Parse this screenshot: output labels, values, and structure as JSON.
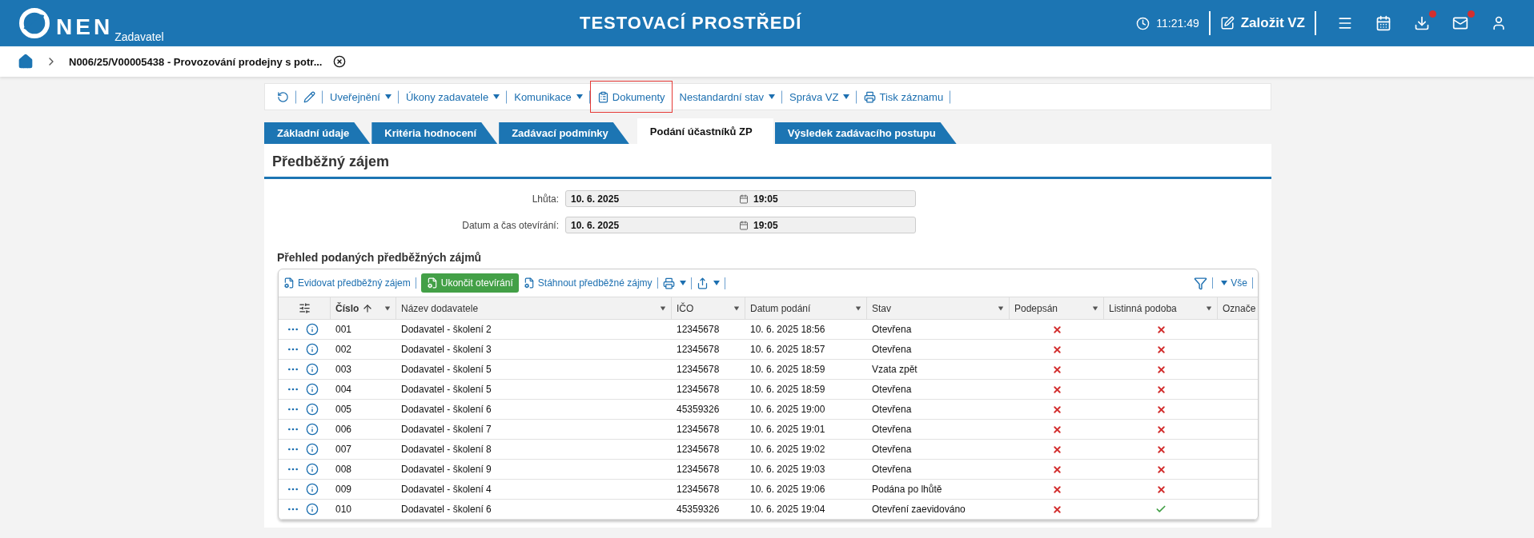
{
  "header": {
    "logo": "NEN",
    "logo_sub": "Zadavatel",
    "environment": "TESTOVACÍ PROSTŘEDÍ",
    "time": "11:21:49",
    "create_button": "Založit VZ",
    "icons": [
      {
        "kind": "menu",
        "badge": false
      },
      {
        "kind": "calendar",
        "badge": false
      },
      {
        "kind": "download",
        "badge": true
      },
      {
        "kind": "mail",
        "badge": true
      },
      {
        "kind": "user",
        "badge": false
      }
    ]
  },
  "breadcrumb": {
    "title": "N006/25/V00005438 - Provozování prodejny s potr..."
  },
  "toolbar": [
    {
      "kind": "refresh"
    },
    {
      "kind": "edit"
    },
    {
      "kind": "menu",
      "label": "Uveřejnění",
      "highlighted": false
    },
    {
      "kind": "menu",
      "label": "Úkony zadavatele",
      "highlighted": false
    },
    {
      "kind": "menu",
      "label": "Komunikace",
      "highlighted": false
    },
    {
      "kind": "doc",
      "label": "Dokumenty",
      "highlighted": true
    },
    {
      "kind": "menu",
      "label": "Nestandardní stav",
      "highlighted": false
    },
    {
      "kind": "menu",
      "label": "Správa VZ",
      "highlighted": false
    },
    {
      "kind": "print",
      "label": "Tisk záznamu",
      "highlighted": false
    }
  ],
  "tabs": [
    {
      "label": "Základní údaje",
      "selected": false
    },
    {
      "label": "Kritéria hodnocení",
      "selected": false
    },
    {
      "label": "Zadávací podmínky",
      "selected": false
    },
    {
      "label": "Podání účastníků ZP",
      "selected": true
    },
    {
      "label": "Výsledek zadávacího postupu",
      "selected": false
    }
  ],
  "section": {
    "title": "Předběžný zájem",
    "fields": [
      {
        "label": "Lhůta:",
        "date": "10. 6. 2025",
        "time": "19:05"
      },
      {
        "label": "Datum a čas otevírání:",
        "date": "10. 6. 2025",
        "time": "19:05"
      }
    ]
  },
  "table": {
    "title": "Přehled podaných předběžných zájmů",
    "actions": [
      {
        "kind": "link",
        "label": "Evidovat předběžný zájem"
      },
      {
        "kind": "primary",
        "label": "Ukončit otevírání"
      },
      {
        "kind": "link",
        "label": "Stáhnout předběžné zájmy"
      },
      {
        "kind": "print"
      },
      {
        "kind": "export"
      }
    ],
    "filter_label": "Vše",
    "columns": [
      {
        "label": "Číslo",
        "sorted": true
      },
      {
        "label": "Název dodavatele",
        "sorted": false
      },
      {
        "label": "IČO",
        "sorted": false
      },
      {
        "label": "Datum podání",
        "sorted": false
      },
      {
        "label": "Stav",
        "sorted": false
      },
      {
        "label": "Podepsán",
        "sorted": false
      },
      {
        "label": "Listinná podoba",
        "sorted": false
      },
      {
        "label": "Označe",
        "sorted": false
      }
    ],
    "rows": [
      {
        "number": "001",
        "supplier": "Dodavatel - školení 2",
        "ico": "12345678",
        "date": "10. 6. 2025 18:56",
        "status": "Otevřena",
        "signed": false,
        "paper": false
      },
      {
        "number": "002",
        "supplier": "Dodavatel - školení 3",
        "ico": "12345678",
        "date": "10. 6. 2025 18:57",
        "status": "Otevřena",
        "signed": false,
        "paper": false
      },
      {
        "number": "003",
        "supplier": "Dodavatel - školení 5",
        "ico": "12345678",
        "date": "10. 6. 2025 18:59",
        "status": "Vzata zpět",
        "signed": false,
        "paper": false
      },
      {
        "number": "004",
        "supplier": "Dodavatel - školení 5",
        "ico": "12345678",
        "date": "10. 6. 2025 18:59",
        "status": "Otevřena",
        "signed": false,
        "paper": false
      },
      {
        "number": "005",
        "supplier": "Dodavatel - školení 6",
        "ico": "45359326",
        "date": "10. 6. 2025 19:00",
        "status": "Otevřena",
        "signed": false,
        "paper": false
      },
      {
        "number": "006",
        "supplier": "Dodavatel - školení 7",
        "ico": "12345678",
        "date": "10. 6. 2025 19:01",
        "status": "Otevřena",
        "signed": false,
        "paper": false
      },
      {
        "number": "007",
        "supplier": "Dodavatel - školení 8",
        "ico": "12345678",
        "date": "10. 6. 2025 19:02",
        "status": "Otevřena",
        "signed": false,
        "paper": false
      },
      {
        "number": "008",
        "supplier": "Dodavatel - školení 9",
        "ico": "12345678",
        "date": "10. 6. 2025 19:03",
        "status": "Otevřena",
        "signed": false,
        "paper": false
      },
      {
        "number": "009",
        "supplier": "Dodavatel - školení 4",
        "ico": "12345678",
        "date": "10. 6. 2025 19:06",
        "status": "Podána po lhůtě",
        "signed": false,
        "paper": false
      },
      {
        "number": "010",
        "supplier": "Dodavatel - školení 6",
        "ico": "45359326",
        "date": "10. 6. 2025 19:04",
        "status": "Otevření zaevidováno",
        "signed": false,
        "paper": true
      }
    ]
  }
}
